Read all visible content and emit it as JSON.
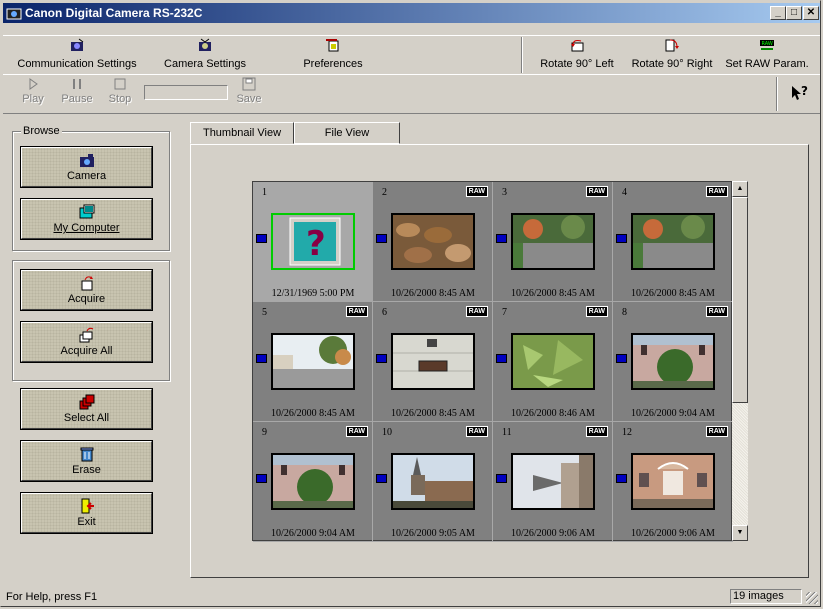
{
  "window": {
    "title": "Canon Digital Camera RS-232C",
    "controls": [
      "_",
      "□",
      "✕"
    ]
  },
  "toolbar_main": {
    "communication_settings": "Communication Settings",
    "camera_settings": "Camera Settings",
    "preferences": "Preferences",
    "rotate_left": "Rotate 90° Left",
    "rotate_right": "Rotate 90° Right",
    "set_raw": "Set RAW Param."
  },
  "toolbar_playback": {
    "play": "Play",
    "pause": "Pause",
    "stop": "Stop",
    "save": "Save",
    "help_glyph": "?"
  },
  "browse": {
    "group_label": "Browse",
    "camera": "Camera",
    "my_computer": "My Computer"
  },
  "acquire": {
    "acquire": "Acquire",
    "acquire_all": "Acquire All"
  },
  "manage": {
    "select_all": "Select All",
    "erase": "Erase",
    "exit": "Exit"
  },
  "tabs": {
    "thumbnail_view": "Thumbnail View",
    "file_view": "File View"
  },
  "thumbnails": [
    {
      "num": "1",
      "date": "12/31/1969 5:00 PM",
      "raw": "",
      "style": "question"
    },
    {
      "num": "2",
      "date": "10/26/2000 8:45 AM",
      "raw": "RAW",
      "style": "leaves"
    },
    {
      "num": "3",
      "date": "10/26/2000 8:45 AM",
      "raw": "RAW",
      "style": "street"
    },
    {
      "num": "4",
      "date": "10/26/2000 8:45 AM",
      "raw": "RAW",
      "style": "street"
    },
    {
      "num": "5",
      "date": "10/26/2000 8:45 AM",
      "raw": "RAW",
      "style": "street2"
    },
    {
      "num": "6",
      "date": "10/26/2000 8:45 AM",
      "raw": "RAW",
      "style": "sign"
    },
    {
      "num": "7",
      "date": "10/26/2000 8:46 AM",
      "raw": "RAW",
      "style": "green"
    },
    {
      "num": "8",
      "date": "10/26/2000 9:04 AM",
      "raw": "RAW",
      "style": "tree"
    },
    {
      "num": "9",
      "date": "10/26/2000 9:04 AM",
      "raw": "RAW",
      "style": "tree"
    },
    {
      "num": "10",
      "date": "10/26/2000 9:05 AM",
      "raw": "RAW",
      "style": "church"
    },
    {
      "num": "11",
      "date": "10/26/2000 9:06 AM",
      "raw": "RAW",
      "style": "spire"
    },
    {
      "num": "12",
      "date": "10/26/2000 9:06 AM",
      "raw": "RAW",
      "style": "building"
    }
  ],
  "status": {
    "help": "For Help, press F1",
    "count": "19 images"
  }
}
